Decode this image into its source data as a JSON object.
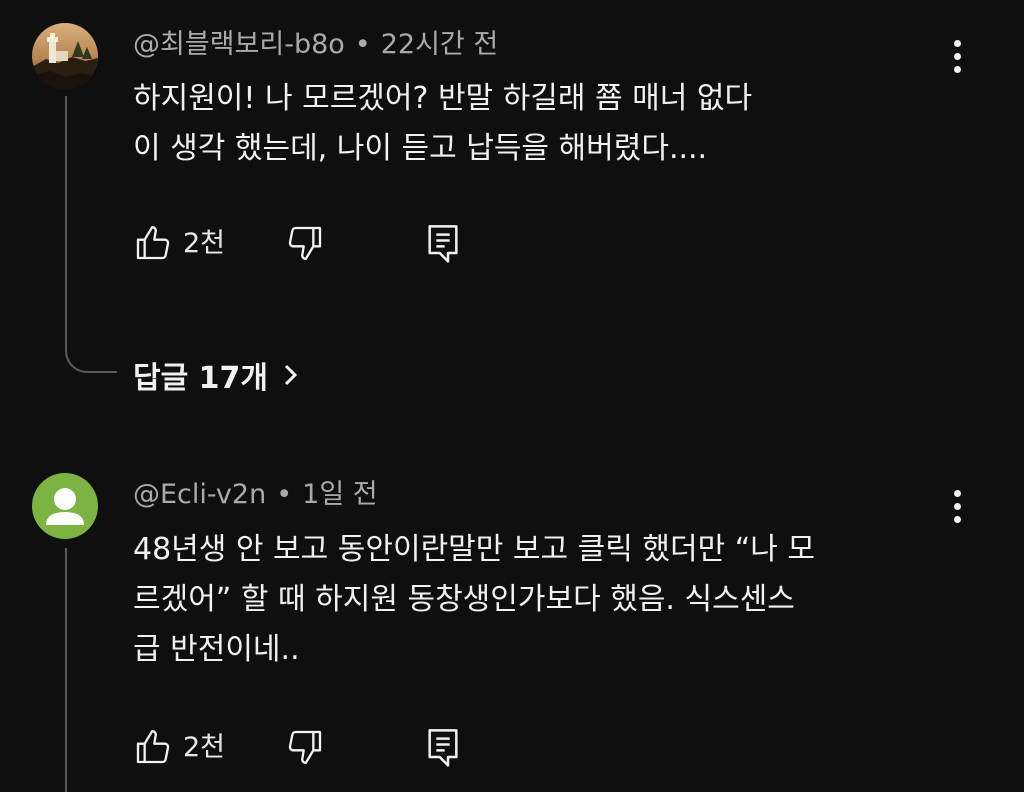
{
  "comments": [
    {
      "author": "@최블랙보리-b8o",
      "separator": "•",
      "time": "22시간 전",
      "lines": [
        "하지원이!  나 모르겠어? 반말 하길래 쬼 매너 없다",
        "이 생각 했는데, 나이 듣고 납득을 해버렸다...."
      ],
      "likes": "2천",
      "avatar": "lighthouse-photo",
      "replies_label": "답글 17개"
    },
    {
      "author": "@Ecli-v2n",
      "separator": "•",
      "time": "1일 전",
      "lines": [
        "48년생 안 보고 동안이란말만 보고 클릭 했더만 “나 모",
        "르겠어” 할 때 하지원 동창생인가보다 했음. 식스센스",
        "급 반전이네.."
      ],
      "likes": "2천",
      "avatar": "default-person",
      "avatar_color": "#7cb342"
    }
  ],
  "icons": {
    "like": "thumbs-up-icon",
    "dislike": "thumbs-down-icon",
    "reply": "reply-comment-icon",
    "more": "more-vertical-icon",
    "chevron": "chevron-right-icon"
  },
  "colors": {
    "background": "#0f0f0f",
    "text": "#f1f1f1",
    "meta": "#aaaaaa",
    "thread": "#5a5a5a"
  }
}
